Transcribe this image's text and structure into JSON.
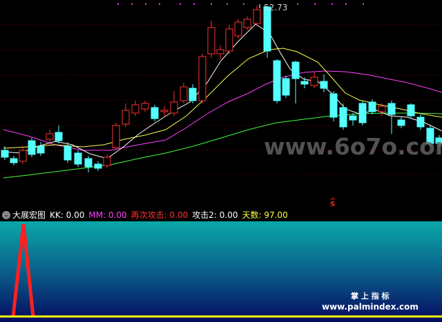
{
  "main_chart": {
    "high_label": "52.73",
    "signal_mark": "S",
    "watermark": "www.6o7o.com"
  },
  "indicator": {
    "name": "大展宏图",
    "items": [
      {
        "label": "KK:",
        "value": "0.00",
        "color": "#ffffff"
      },
      {
        "label": "MM:",
        "value": "0.00",
        "color": "#ff40ff"
      },
      {
        "label": "再次攻击:",
        "value": "0.00",
        "color": "#ff3030"
      },
      {
        "label": "攻击2:",
        "value": "0.00",
        "color": "#ffffff"
      },
      {
        "label": "天数:",
        "value": "97.00",
        "color": "#ffff40"
      }
    ]
  },
  "sub_chart": {
    "brand_cn": "掌 上 指 标",
    "brand_url": "www.palmindex.com"
  },
  "colors": {
    "up": "#ff3232",
    "down": "#54ffff",
    "ma_white": "#ffffff",
    "ma_yellow": "#ffff50",
    "ma_magenta": "#ff40ff",
    "ma_green": "#40ff40",
    "signal": "#ff2020",
    "spike": "#ff2020",
    "baseline": "#ffff00"
  },
  "chart_data": {
    "type": "candlestick",
    "ohlc_sample": [
      {
        "open": 0.54,
        "close": 0.57
      },
      {
        "open": 0.57,
        "close": 0.46
      },
      {
        "open": 0.46,
        "close": 0.52
      },
      {
        "open": 0.52,
        "close": 0.55
      }
    ]
  }
}
